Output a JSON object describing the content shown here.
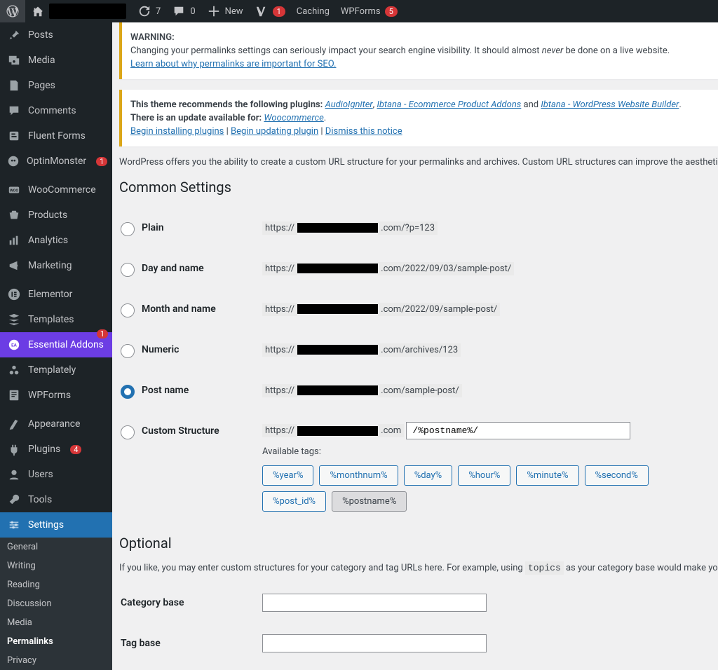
{
  "toolbar": {
    "updates_count": "7",
    "comments_badge": "0",
    "new_label": "New",
    "wpforms_label": "WPForms",
    "wpforms_badge": "5",
    "yoast_badge": "1",
    "caching_label": "Caching"
  },
  "sidebar": {
    "items": [
      {
        "label": "Posts",
        "icon": "pin"
      },
      {
        "label": "Media",
        "icon": "media"
      },
      {
        "label": "Pages",
        "icon": "pages"
      },
      {
        "label": "Comments",
        "icon": "comments"
      },
      {
        "label": "Fluent Forms",
        "icon": "fluent"
      },
      {
        "label": "OptinMonster",
        "icon": "optin",
        "badge": "1"
      },
      {
        "sep": true
      },
      {
        "label": "WooCommerce",
        "icon": "woo"
      },
      {
        "label": "Products",
        "icon": "products"
      },
      {
        "label": "Analytics",
        "icon": "analytics"
      },
      {
        "label": "Marketing",
        "icon": "marketing"
      },
      {
        "sep": true
      },
      {
        "label": "Elementor",
        "icon": "elementor"
      },
      {
        "label": "Templates",
        "icon": "templates"
      },
      {
        "label": "Essential Addons",
        "icon": "ea",
        "badge": "1",
        "purple": true
      },
      {
        "label": "Templately",
        "icon": "templately"
      },
      {
        "label": "WPForms",
        "icon": "wpforms"
      },
      {
        "sep": true
      },
      {
        "label": "Appearance",
        "icon": "appearance"
      },
      {
        "label": "Plugins",
        "icon": "plugins",
        "badge": "4"
      },
      {
        "label": "Users",
        "icon": "users"
      },
      {
        "label": "Tools",
        "icon": "tools"
      },
      {
        "label": "Settings",
        "icon": "settings",
        "active": true
      }
    ],
    "submenu": [
      {
        "label": "General"
      },
      {
        "label": "Writing"
      },
      {
        "label": "Reading"
      },
      {
        "label": "Discussion"
      },
      {
        "label": "Media"
      },
      {
        "label": "Permalinks",
        "current": true
      },
      {
        "label": "Privacy"
      }
    ]
  },
  "notices": {
    "warning_title": "WARNING:",
    "warning_text_1": "Changing your permalinks settings can seriously impact your search engine visibility. It should almost ",
    "warning_never": "never",
    "warning_text_2": " be done on a live website.",
    "warning_link": "Learn about why permalinks are important for SEO.",
    "theme_rec": "This theme recommends the following plugins: ",
    "plugin1": "AudioIgniter",
    "plugin2": "Ibtana - Ecommerce Product Addons",
    "plugin3": "Ibtana - WordPress Website Builder",
    "and_word": " and ",
    "update_text": "There is an update available for: ",
    "update_plugin": "Woocommerce",
    "begin_install": "Begin installing plugins",
    "begin_update": "Begin updating plugin",
    "dismiss": "Dismiss this notice"
  },
  "intro": "WordPress offers you the ability to create a custom URL structure for your permalinks and archives. Custom URL structures can improve the aesthetics, usability, a",
  "common_heading": "Common Settings",
  "permalinks": {
    "plain": {
      "label": "Plain",
      "pre": "https://",
      "suf": ".com/?p=123"
    },
    "dayname": {
      "label": "Day and name",
      "pre": "https://",
      "suf": ".com/2022/09/03/sample-post/"
    },
    "monthname": {
      "label": "Month and name",
      "pre": "https://",
      "suf": ".com/2022/09/sample-post/"
    },
    "numeric": {
      "label": "Numeric",
      "pre": "https://",
      "suf": ".com/archives/123"
    },
    "postname": {
      "label": "Post name",
      "pre": "https://",
      "suf": ".com/sample-post/",
      "checked": true
    },
    "custom": {
      "label": "Custom Structure",
      "pre": "https://",
      "suf": ".com",
      "value": "/%postname%/"
    }
  },
  "available_tags_label": "Available tags:",
  "tags": [
    {
      "label": "%year%"
    },
    {
      "label": "%monthnum%"
    },
    {
      "label": "%day%"
    },
    {
      "label": "%hour%"
    },
    {
      "label": "%minute%"
    },
    {
      "label": "%second%"
    },
    {
      "label": "%post_id%"
    },
    {
      "label": "%postname%",
      "active": true
    }
  ],
  "optional_heading": "Optional",
  "optional_desc_1": "If you like, you may enter custom structures for your category and tag URLs here. For example, using ",
  "optional_code": "topics",
  "optional_desc_2": " as your category base would make your category ",
  "category_base_label": "Category base",
  "tag_base_label": "Tag base",
  "category_base_value": "",
  "tag_base_value": ""
}
